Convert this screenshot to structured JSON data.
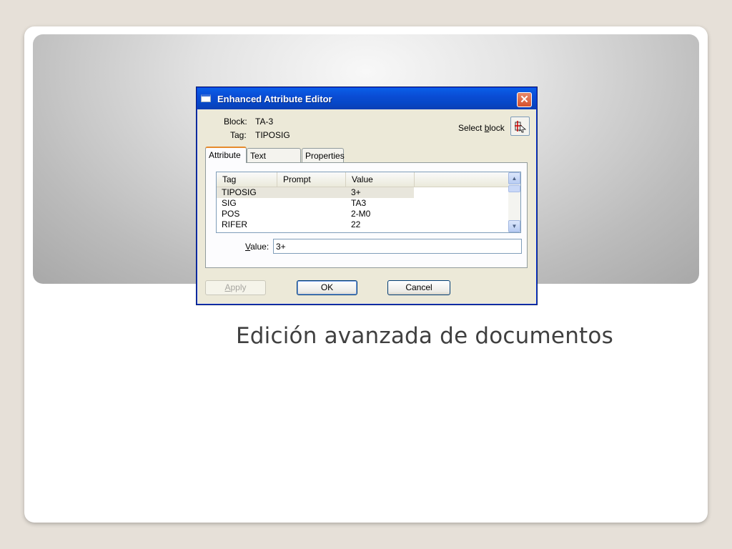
{
  "slide": {
    "caption": "Edición avanzada de documentos"
  },
  "dialog": {
    "title": "Enhanced Attribute Editor",
    "close_label": "✕",
    "block_label": "Block:",
    "block_value": "TA-3",
    "tag_label": "Tag:",
    "tag_value": "TIPOSIG",
    "select_block_label": "Select block",
    "tabs": [
      {
        "label": "Attribute",
        "active": true
      },
      {
        "label": "Text Options",
        "active": false
      },
      {
        "label": "Properties",
        "active": false
      }
    ],
    "attributes_table": {
      "columns": [
        "Tag",
        "Prompt",
        "Value"
      ],
      "rows": [
        {
          "tag": "TIPOSIG",
          "prompt": "",
          "value": "3+",
          "selected": true
        },
        {
          "tag": "SIG",
          "prompt": "",
          "value": "TA3",
          "selected": false
        },
        {
          "tag": "POS",
          "prompt": "",
          "value": "2-M0",
          "selected": false
        },
        {
          "tag": "RIFER",
          "prompt": "",
          "value": "22",
          "selected": false
        }
      ]
    },
    "value_label": "Value:",
    "value_field": "3+",
    "buttons": {
      "apply": "Apply",
      "ok": "OK",
      "cancel": "Cancel"
    }
  },
  "colors": {
    "titlebar": "#0a4cd4",
    "dialog_bg": "#ece9d8",
    "close_button": "#d6502c",
    "active_tab_accent": "#e68b2c"
  }
}
